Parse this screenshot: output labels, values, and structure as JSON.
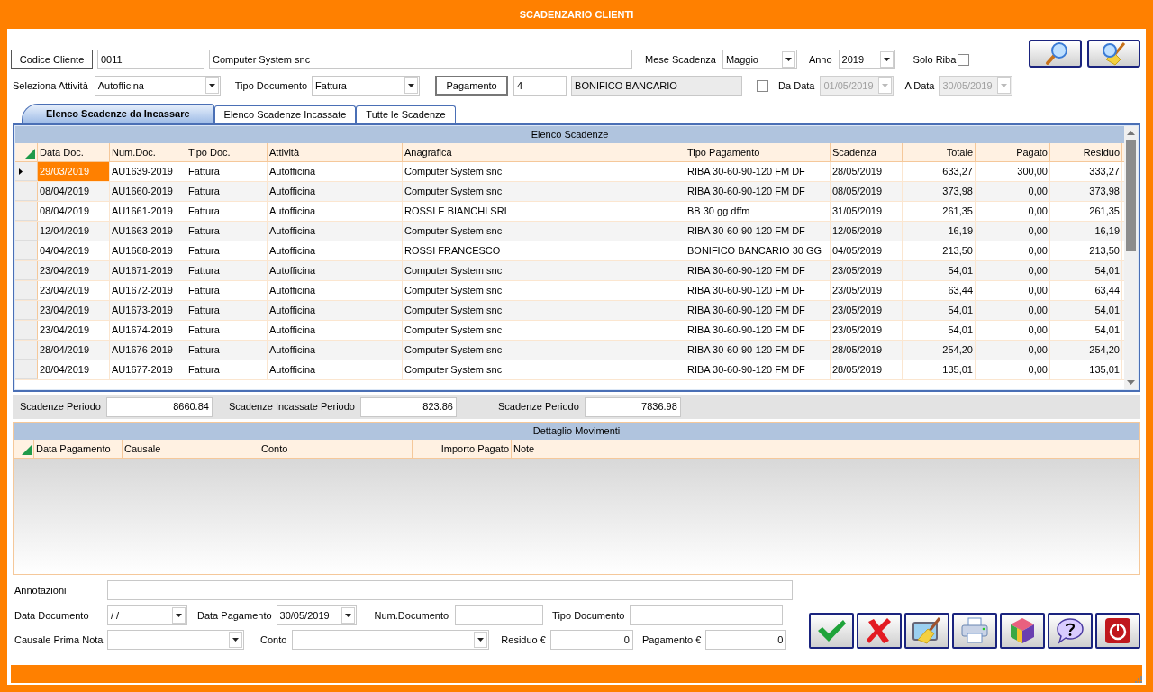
{
  "window": {
    "title": "SCADENZARIO CLIENTI"
  },
  "filters": {
    "customer_button": "Codice Cliente",
    "customer_code": "0011",
    "customer_name": "Computer System snc",
    "month_label": "Mese Scadenza",
    "month": "Maggio",
    "year_label": "Anno",
    "year": "2019",
    "solo_riba": {
      "label": "Solo Riba",
      "checked": false
    },
    "activity_label": "Seleziona Attività",
    "activity": "Autofficina",
    "doc_type_label": "Tipo Documento",
    "doc_type": "Fattura",
    "payment_button": "Pagamento",
    "payment_code": "4",
    "payment_name": "BONIFICO BANCARIO",
    "date_range": {
      "checked": false,
      "from_label": "Da Data",
      "from": "01/05/2019",
      "to_label": "A Data",
      "to": "30/05/2019",
      "disabled": true
    }
  },
  "tabs": [
    {
      "label": "Elenco Scadenze da Incassare",
      "selected": true
    },
    {
      "label": "Elenco Scadenze Incassate",
      "selected": false
    },
    {
      "label": "Tutte le Scadenze",
      "selected": false
    }
  ],
  "grid": {
    "title": "Elenco Scadenze",
    "columns": [
      {
        "label": "Data Doc.",
        "kind": "text"
      },
      {
        "label": "Num.Doc.",
        "kind": "text"
      },
      {
        "label": "Tipo Doc.",
        "kind": "text"
      },
      {
        "label": "Attività",
        "kind": "text"
      },
      {
        "label": "Anagrafica",
        "kind": "text"
      },
      {
        "label": "Tipo Pagamento",
        "kind": "text"
      },
      {
        "label": "Scadenza",
        "kind": "text"
      },
      {
        "label": "Totale",
        "kind": "number"
      },
      {
        "label": "Pagato",
        "kind": "number"
      },
      {
        "label": "Residuo",
        "kind": "number"
      }
    ],
    "rows": [
      {
        "selected": true,
        "cells": [
          "29/03/2019",
          "AU1639-2019",
          "Fattura",
          "Autofficina",
          "Computer System snc",
          "RIBA 30-60-90-120 FM DF",
          "28/05/2019",
          "633,27",
          "300,00",
          "333,27"
        ]
      },
      {
        "selected": false,
        "cells": [
          "08/04/2019",
          "AU1660-2019",
          "Fattura",
          "Autofficina",
          "Computer System snc",
          "RIBA 30-60-90-120 FM DF",
          "08/05/2019",
          "373,98",
          "0,00",
          "373,98"
        ]
      },
      {
        "selected": false,
        "cells": [
          "08/04/2019",
          "AU1661-2019",
          "Fattura",
          "Autofficina",
          "ROSSI E BIANCHI SRL",
          "BB 30 gg dffm",
          "31/05/2019",
          "261,35",
          "0,00",
          "261,35"
        ]
      },
      {
        "selected": false,
        "cells": [
          "12/04/2019",
          "AU1663-2019",
          "Fattura",
          "Autofficina",
          "Computer System snc",
          "RIBA 30-60-90-120 FM DF",
          "12/05/2019",
          "16,19",
          "0,00",
          "16,19"
        ]
      },
      {
        "selected": false,
        "cells": [
          "04/04/2019",
          "AU1668-2019",
          "Fattura",
          "Autofficina",
          "ROSSI FRANCESCO",
          "BONIFICO BANCARIO 30 GG",
          "04/05/2019",
          "213,50",
          "0,00",
          "213,50"
        ]
      },
      {
        "selected": false,
        "cells": [
          "23/04/2019",
          "AU1671-2019",
          "Fattura",
          "Autofficina",
          "Computer System snc",
          "RIBA 30-60-90-120 FM DF",
          "23/05/2019",
          "54,01",
          "0,00",
          "54,01"
        ]
      },
      {
        "selected": false,
        "cells": [
          "23/04/2019",
          "AU1672-2019",
          "Fattura",
          "Autofficina",
          "Computer System snc",
          "RIBA 30-60-90-120 FM DF",
          "23/05/2019",
          "63,44",
          "0,00",
          "63,44"
        ]
      },
      {
        "selected": false,
        "cells": [
          "23/04/2019",
          "AU1673-2019",
          "Fattura",
          "Autofficina",
          "Computer System snc",
          "RIBA 30-60-90-120 FM DF",
          "23/05/2019",
          "54,01",
          "0,00",
          "54,01"
        ]
      },
      {
        "selected": false,
        "cells": [
          "23/04/2019",
          "AU1674-2019",
          "Fattura",
          "Autofficina",
          "Computer System snc",
          "RIBA 30-60-90-120 FM DF",
          "23/05/2019",
          "54,01",
          "0,00",
          "54,01"
        ]
      },
      {
        "selected": false,
        "cells": [
          "28/04/2019",
          "AU1676-2019",
          "Fattura",
          "Autofficina",
          "Computer System snc",
          "RIBA 30-60-90-120 FM DF",
          "28/05/2019",
          "254,20",
          "0,00",
          "254,20"
        ]
      },
      {
        "selected": false,
        "cells": [
          "28/04/2019",
          "AU1677-2019",
          "Fattura",
          "Autofficina",
          "Computer System snc",
          "RIBA 30-60-90-120 FM DF",
          "28/05/2019",
          "135,01",
          "0,00",
          "135,01"
        ]
      }
    ]
  },
  "totals": [
    {
      "label": "Scadenze Periodo",
      "value": "8660.84"
    },
    {
      "label": "Scadenze Incassate Periodo",
      "value": "823.86"
    },
    {
      "label": "Scadenze Periodo",
      "value": "7836.98"
    }
  ],
  "detail": {
    "title": "Dettaglio Movimenti",
    "columns": [
      {
        "label": "Data Pagamento",
        "kind": "text"
      },
      {
        "label": "Causale",
        "kind": "text"
      },
      {
        "label": "Conto",
        "kind": "text"
      },
      {
        "label": "Importo Pagato",
        "kind": "number"
      },
      {
        "label": "Note",
        "kind": "text"
      }
    ]
  },
  "form": {
    "annotations_label": "Annotazioni",
    "doc_date_label": "Data Documento",
    "doc_date": "/ /",
    "pay_date_label": "Data Pagamento",
    "pay_date": "30/05/2019",
    "doc_num_label": "Num.Documento",
    "doc_type_label": "Tipo Documento",
    "causale_label": "Causale Prima Nota",
    "conto_label": "Conto",
    "residuo_label": "Residuo €",
    "residuo": "0",
    "pagamento_label": "Pagamento €",
    "pagamento": "0"
  }
}
